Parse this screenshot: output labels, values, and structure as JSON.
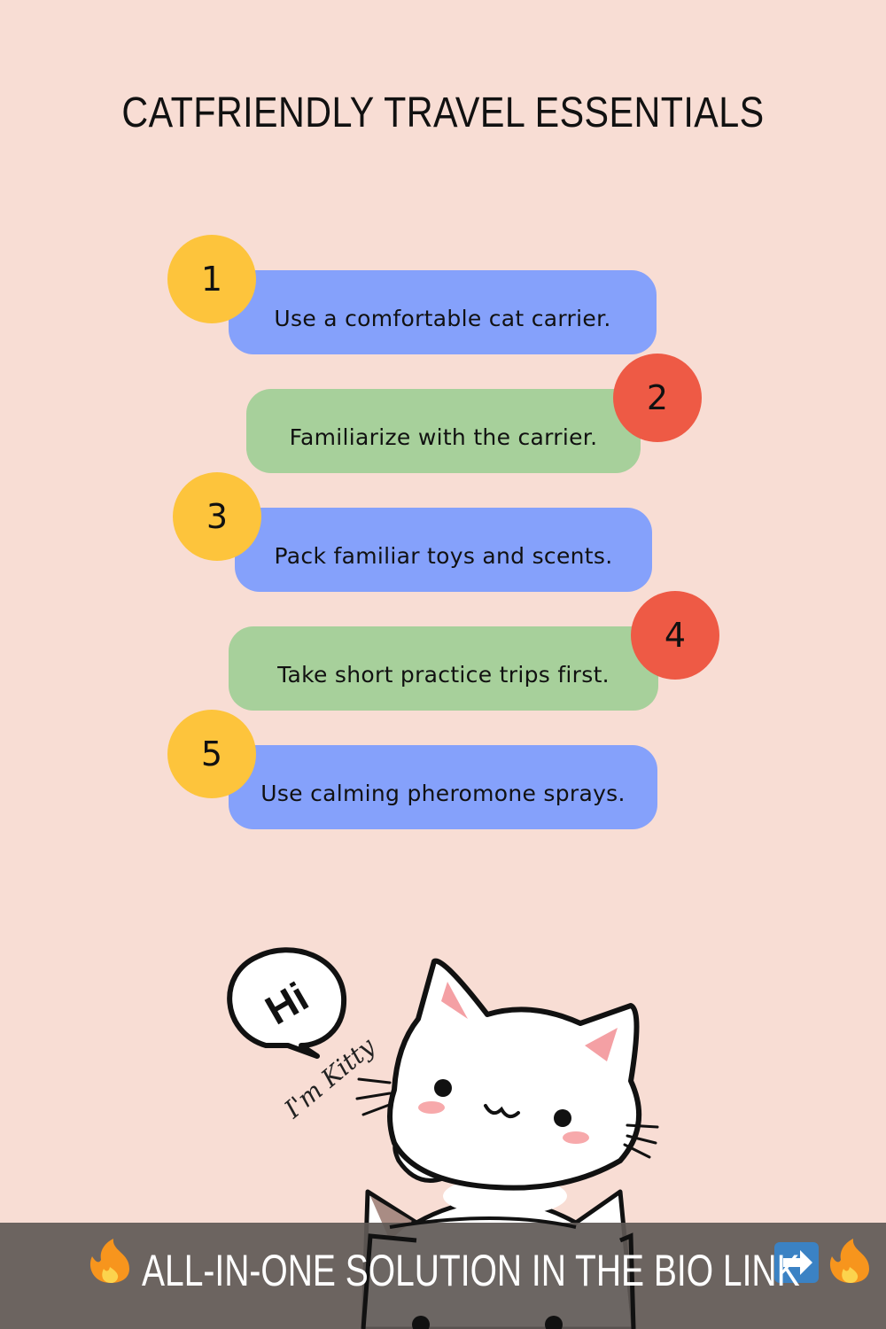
{
  "title": "CATFRIENDLY TRAVEL ESSENTIALS",
  "steps": [
    {
      "number": "1",
      "text": "Use a comfortable cat carrier."
    },
    {
      "number": "2",
      "text": "Familiarize with the carrier."
    },
    {
      "number": "3",
      "text": "Pack familiar toys and scents."
    },
    {
      "number": "4",
      "text": "Take short practice trips first."
    },
    {
      "number": "5",
      "text": "Use calming pheromone sprays."
    }
  ],
  "illustration": {
    "bubble_text": "Hi",
    "caption": "I'm Kitty"
  },
  "banner": {
    "text": "ALL-IN-ONE SOLUTION IN THE BIO LINK"
  },
  "colors": {
    "background": "#f8ddd4",
    "blue_pill": "#85a1fb",
    "green_pill": "#a7d09b",
    "yellow_badge": "#fdc43c",
    "red_badge": "#ee5a45"
  },
  "icons": [
    "fire-icon",
    "right-arrow-icon",
    "fire-icon"
  ]
}
